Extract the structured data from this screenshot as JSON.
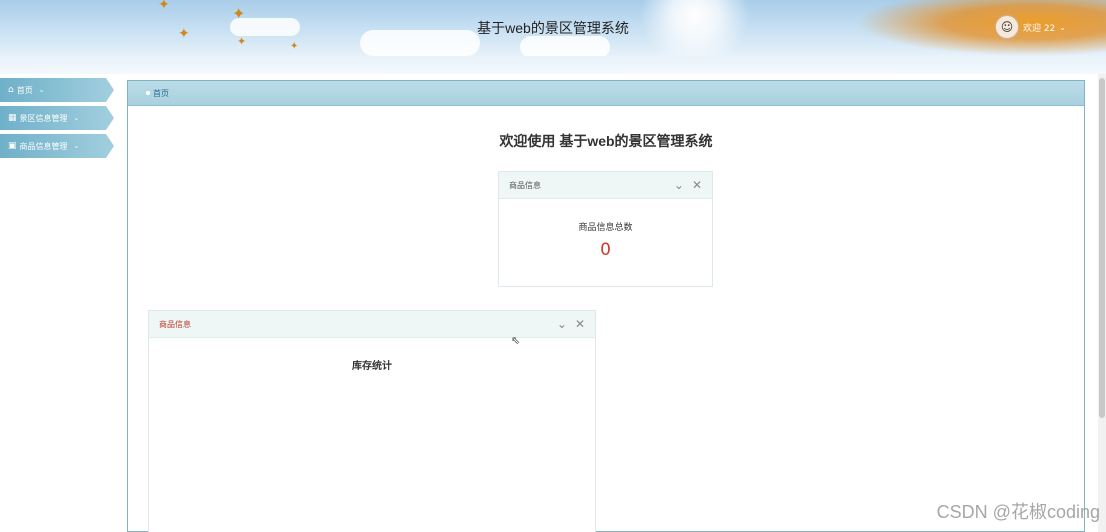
{
  "header": {
    "title": "基于web的景区管理系统",
    "user_name": "欢迎 22",
    "avatar_icon": "user-avatar-icon",
    "caret_icon": "chevron-down-icon"
  },
  "sidebar": {
    "items": [
      {
        "label": "首页",
        "icon": "home-icon"
      },
      {
        "label": "景区信息管理",
        "icon": "grid-icon"
      },
      {
        "label": "商品信息管理",
        "icon": "shop-icon"
      }
    ]
  },
  "breadcrumb": {
    "label": "首页"
  },
  "main": {
    "welcome": "欢迎使用 基于web的景区管理系统",
    "stat_panel": {
      "title": "商品信息",
      "label": "商品信息总数",
      "value": "0",
      "collapse_icon": "chevron-down-icon",
      "close_icon": "close-icon"
    },
    "chart_panel": {
      "title": "商品信息",
      "chart_title": "库存统计",
      "collapse_icon": "chevron-down-icon",
      "close_icon": "close-icon"
    }
  },
  "watermark": "CSDN @花椒coding",
  "colors": {
    "accent": "#6fb0c9",
    "stat_value": "#d03a2c",
    "panel_header": "#eef6f6"
  }
}
